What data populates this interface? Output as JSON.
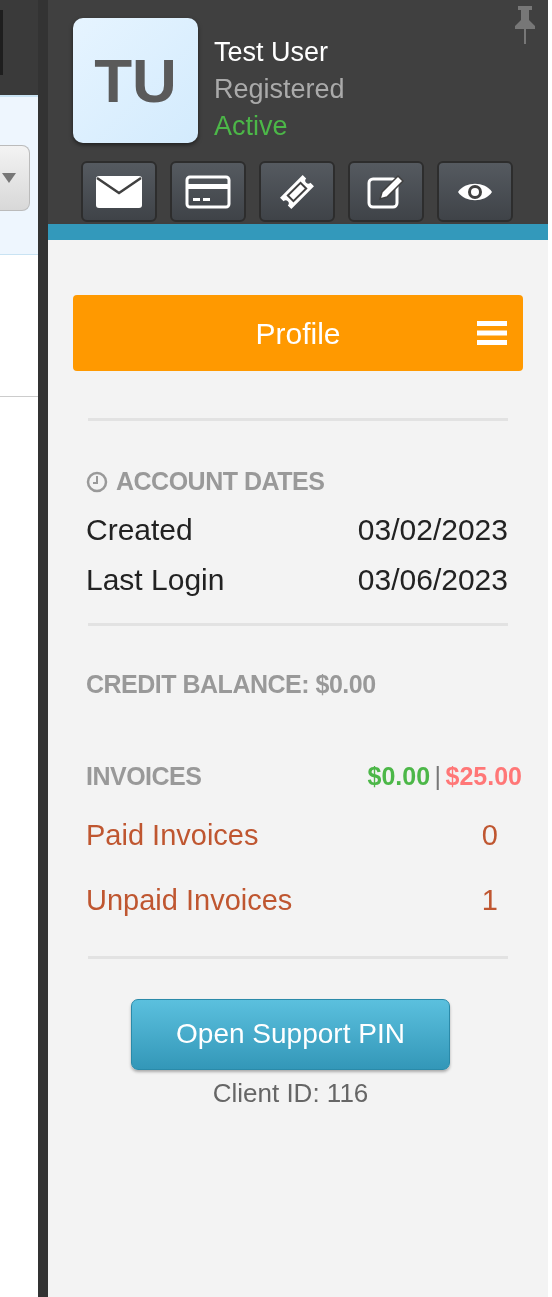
{
  "user": {
    "initials": "TU",
    "name": "Test User",
    "role": "Registered",
    "status": "Active"
  },
  "menu": {
    "title": "Profile"
  },
  "account_dates": {
    "heading": "ACCOUNT DATES",
    "rows": [
      {
        "label": "Created",
        "value": "03/02/2023"
      },
      {
        "label": "Last Login",
        "value": "03/06/2023"
      }
    ]
  },
  "credit_balance": "CREDIT BALANCE: $0.00",
  "invoices": {
    "heading": "INVOICES",
    "paid_total": "$0.00",
    "separator": "|",
    "unpaid_total": "$25.00",
    "rows": [
      {
        "label": "Paid Invoices",
        "count": "0"
      },
      {
        "label": "Unpaid Invoices",
        "count": "1"
      }
    ]
  },
  "support_button": "Open Support PIN",
  "client_id": "Client ID: 116"
}
